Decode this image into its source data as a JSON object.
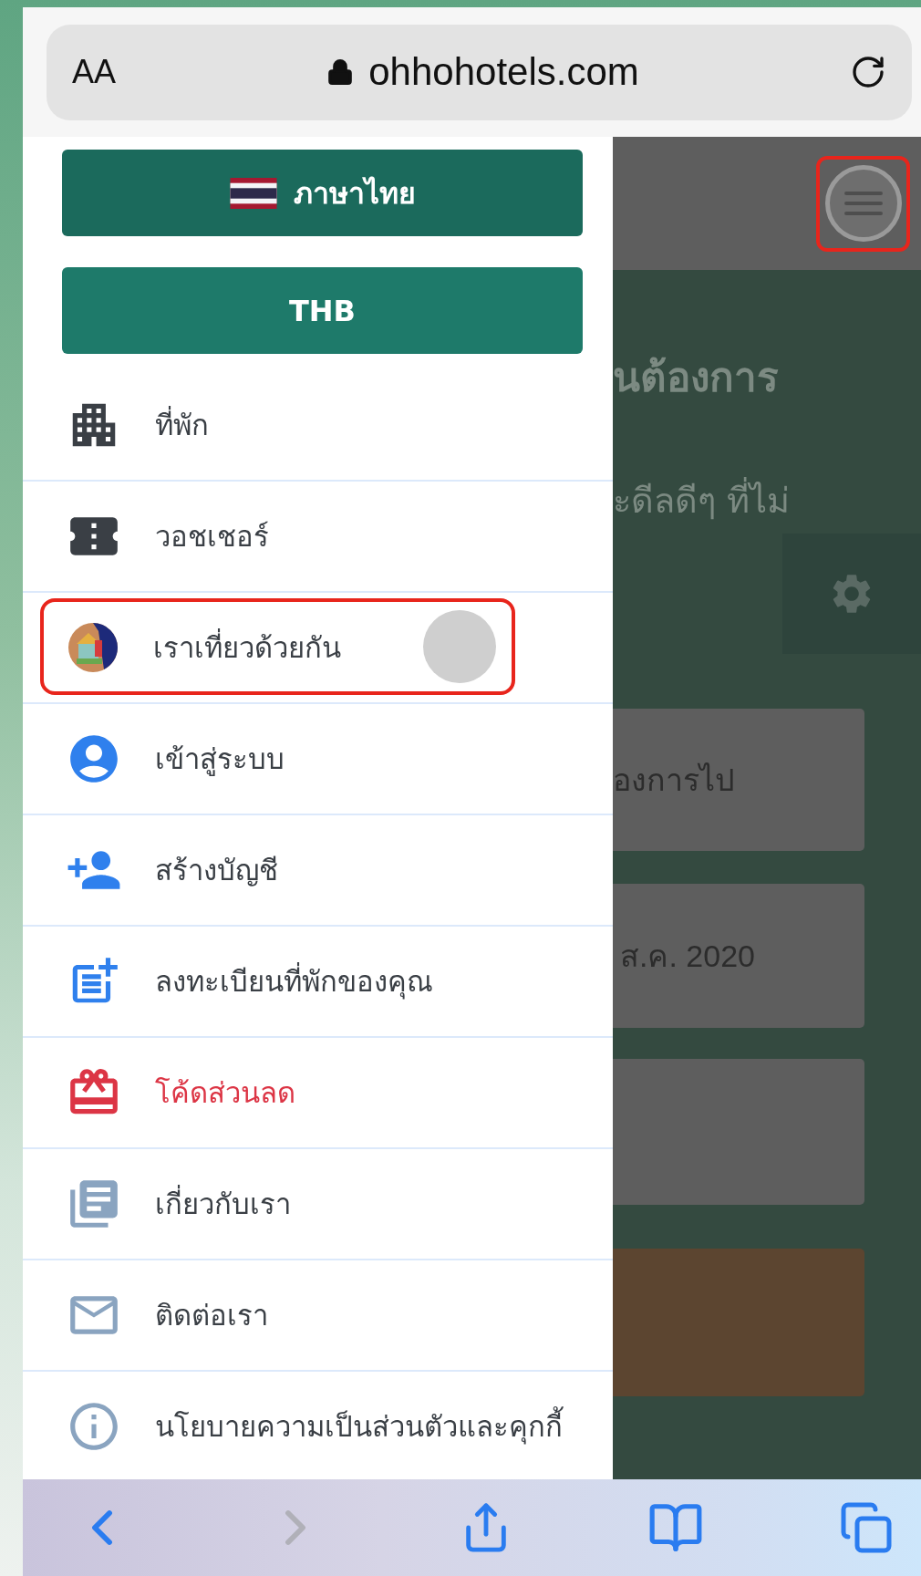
{
  "browser": {
    "text_size_button": "AA",
    "url": "ohhohotels.com"
  },
  "drawer": {
    "language_button": "ภาษาไทย",
    "currency_button": "THB",
    "items": [
      {
        "label": "ที่พัก",
        "emphasized": false,
        "highlighted": false,
        "tapped": false
      },
      {
        "label": "วอชเชอร์",
        "emphasized": false,
        "highlighted": false,
        "tapped": false
      },
      {
        "label": "เราเที่ยวด้วยกัน",
        "emphasized": false,
        "highlighted": true,
        "tapped": true
      },
      {
        "label": "เข้าสู่ระบบ",
        "emphasized": false,
        "highlighted": false,
        "tapped": false
      },
      {
        "label": "สร้างบัญชี",
        "emphasized": false,
        "highlighted": false,
        "tapped": false
      },
      {
        "label": "ลงทะเบียนที่พักของคุณ",
        "emphasized": false,
        "highlighted": false,
        "tapped": false
      },
      {
        "label": "โค้ดส่วนลด",
        "emphasized": true,
        "highlighted": false,
        "tapped": false
      },
      {
        "label": "เกี่ยวกับเรา",
        "emphasized": false,
        "highlighted": false,
        "tapped": false
      },
      {
        "label": "ติดต่อเรา",
        "emphasized": false,
        "highlighted": false,
        "tapped": false
      },
      {
        "label": "นโยบายความเป็นส่วนตัวและคุกกี้",
        "emphasized": false,
        "highlighted": false,
        "tapped": false
      }
    ]
  },
  "background_page": {
    "menu_button_highlighted": true,
    "heading_fragment": "นต้องการ",
    "subtitle_fragment": "ะดีลดีๆ ที่ไม่",
    "destination_field": "องการไป",
    "date_field": "ส.ค. 2020"
  },
  "toolbar": {
    "back_enabled": true,
    "forward_enabled": false
  }
}
